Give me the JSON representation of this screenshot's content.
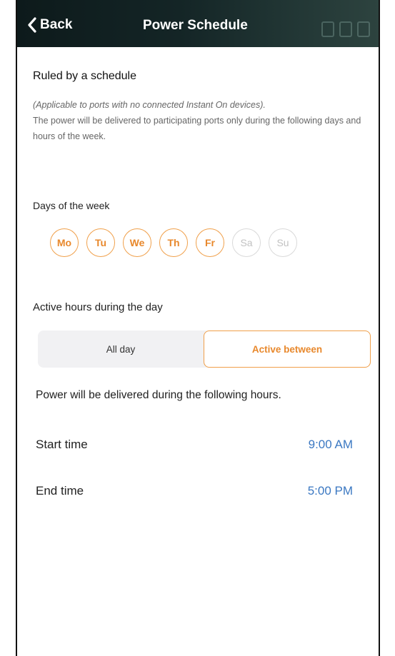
{
  "header": {
    "back_label": "Back",
    "title": "Power Schedule"
  },
  "schedule": {
    "title": "Ruled by a schedule",
    "note": "(Applicable to ports with no connected Instant On devices).",
    "description": "The power will be delivered to participating ports only during the following days and hours of the week."
  },
  "days": {
    "label": "Days of the week",
    "items": [
      {
        "label": "Mo",
        "selected": true
      },
      {
        "label": "Tu",
        "selected": true
      },
      {
        "label": "We",
        "selected": true
      },
      {
        "label": "Th",
        "selected": true
      },
      {
        "label": "Fr",
        "selected": true
      },
      {
        "label": "Sa",
        "selected": false
      },
      {
        "label": "Su",
        "selected": false
      }
    ]
  },
  "hours": {
    "label": "Active hours during the day",
    "options": [
      {
        "label": "All day",
        "selected": false
      },
      {
        "label": "Active between",
        "selected": true
      }
    ],
    "note": "Power will be delivered during the following hours.",
    "start": {
      "label": "Start time",
      "value": "9:00 AM"
    },
    "end": {
      "label": "End time",
      "value": "5:00 PM"
    }
  },
  "colors": {
    "accent": "#e8882c",
    "link": "#3b78c2",
    "header_bg": "#142526"
  },
  "icons": {
    "back": "chevron-left-icon"
  }
}
